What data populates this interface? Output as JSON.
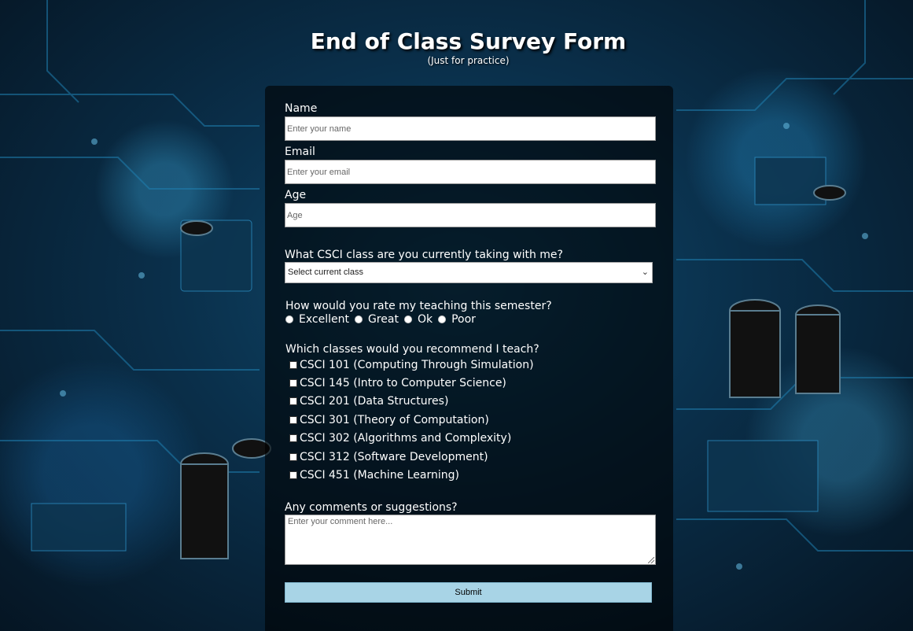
{
  "header": {
    "title": "End of Class Survey Form",
    "subtitle": "(Just for practice)"
  },
  "form": {
    "name": {
      "label": "Name",
      "placeholder": "Enter your name",
      "value": ""
    },
    "email": {
      "label": "Email",
      "placeholder": "Enter your email",
      "value": ""
    },
    "age": {
      "label": "Age",
      "placeholder": "Age",
      "value": ""
    },
    "class_select": {
      "label": "What CSCI class are you currently taking with me?",
      "selected": "Select current class"
    },
    "rating": {
      "question": "How would you rate my teaching this semester?",
      "options": [
        "Excellent",
        "Great",
        "Ok",
        "Poor"
      ]
    },
    "recommend": {
      "question": "Which classes would you recommend I teach?",
      "options": [
        "CSCI 101 (Computing Through Simulation)",
        "CSCI 145 (Intro to Computer Science)",
        "CSCI 201 (Data Structures)",
        "CSCI 301 (Theory of Computation)",
        "CSCI 302 (Algorithms and Complexity)",
        "CSCI 312 (Software Development)",
        "CSCI 451 (Machine Learning)"
      ]
    },
    "comments": {
      "label": "Any comments or suggestions?",
      "placeholder": "Enter your comment here..."
    },
    "submit_label": "Submit"
  },
  "colors": {
    "panel": "#000000",
    "submit": "#a8d4e6",
    "text": "#ffffff"
  }
}
